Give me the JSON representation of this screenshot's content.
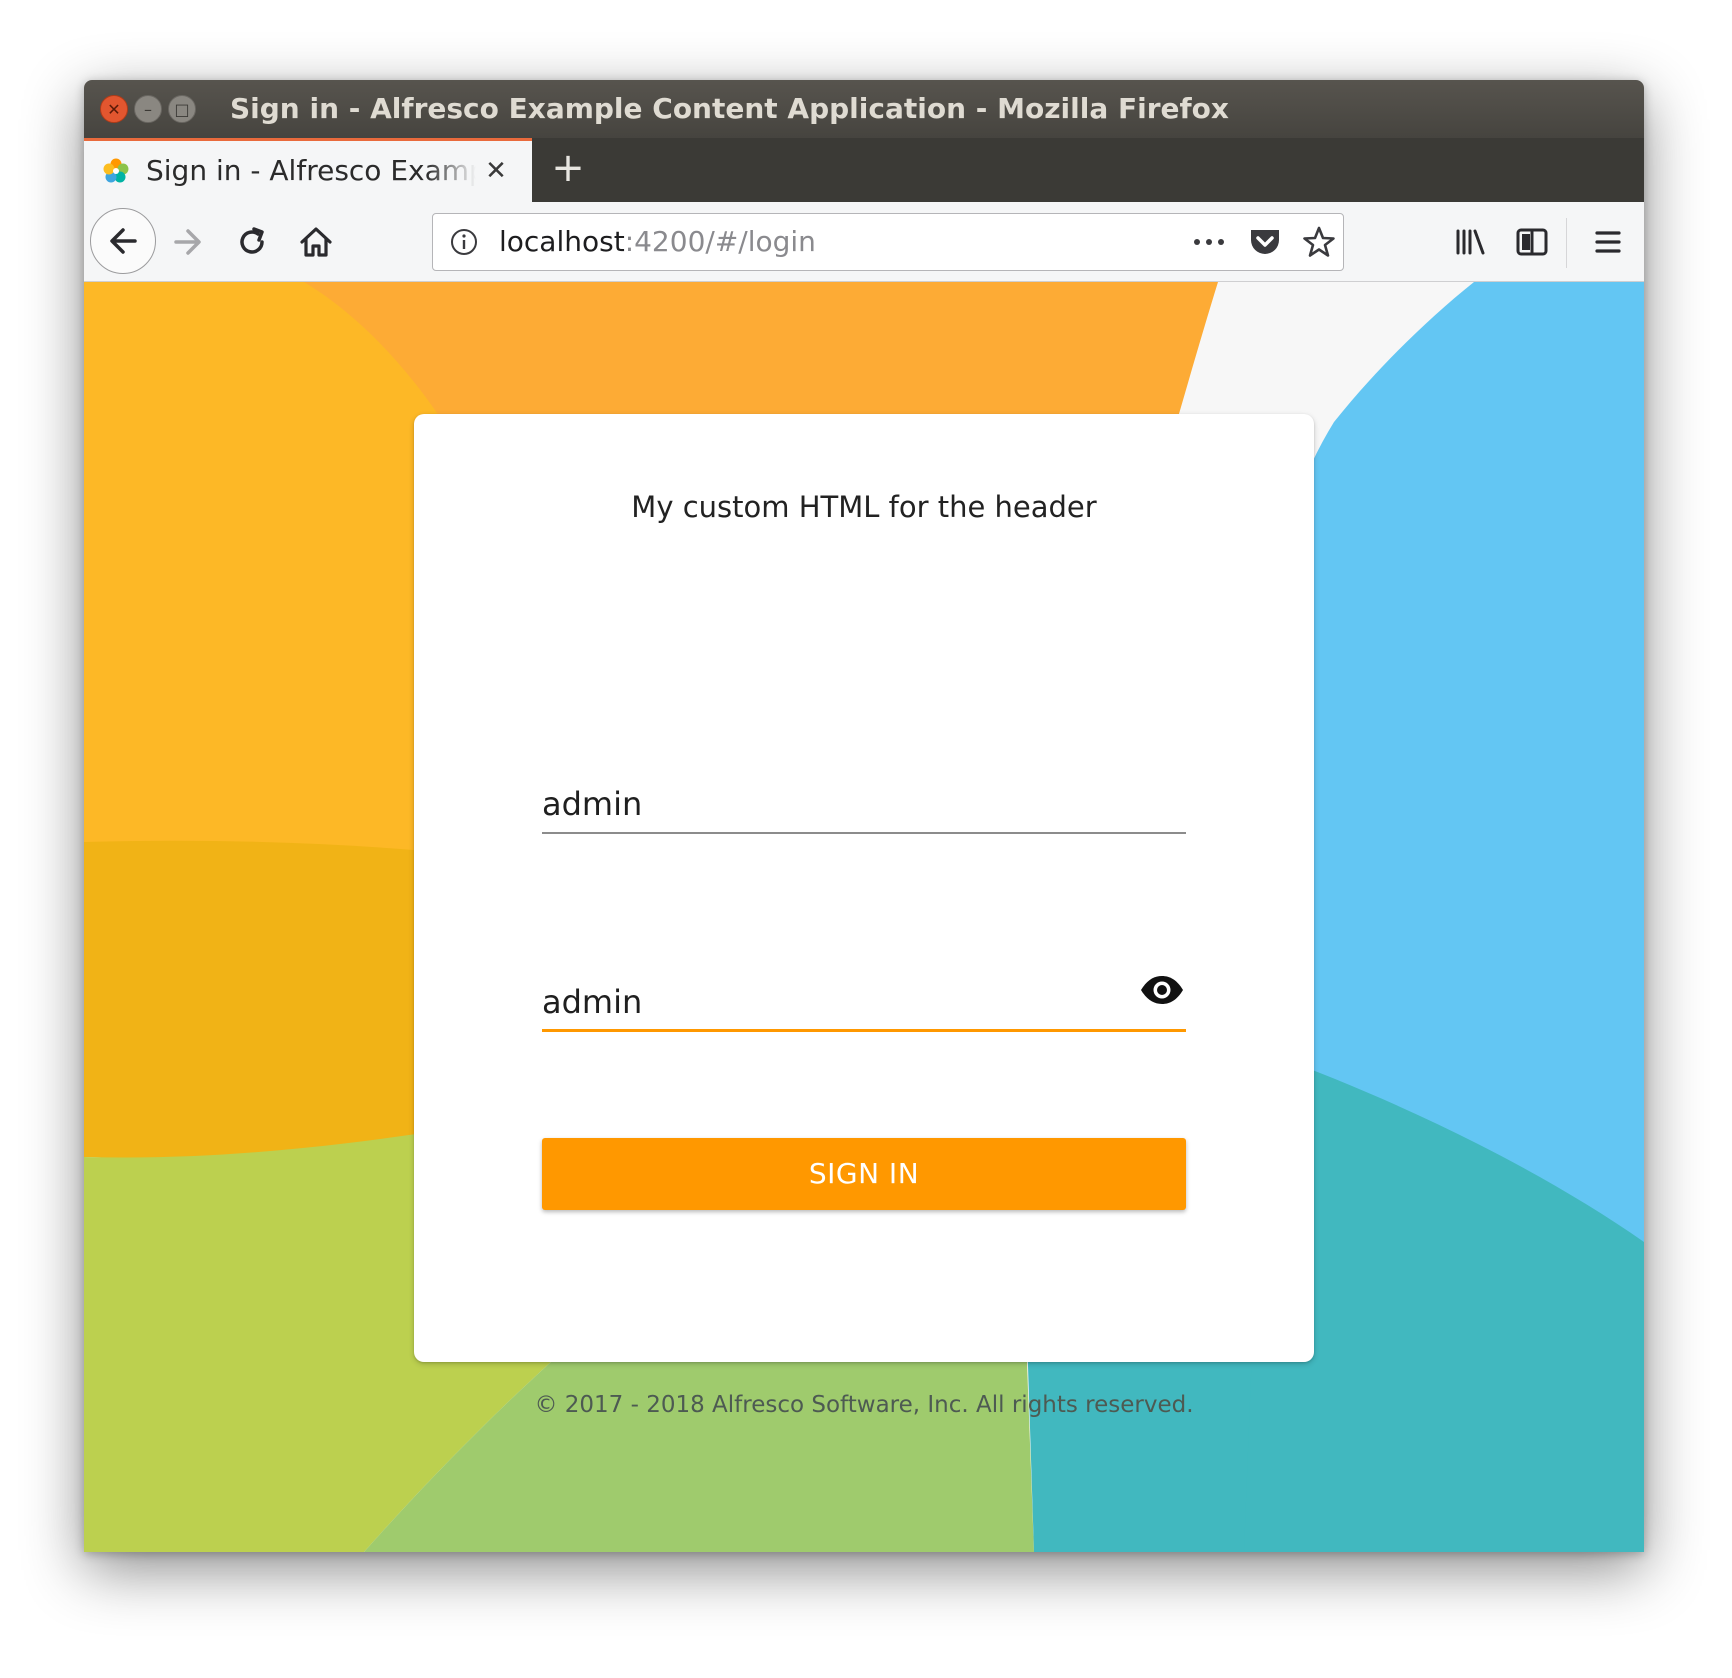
{
  "window": {
    "title": "Sign in - Alfresco Example Content Application - Mozilla Firefox"
  },
  "tab": {
    "title": "Sign in - Alfresco Example Content Application",
    "close_icon": "close-icon",
    "new_tab_icon": "plus-icon"
  },
  "navbar": {
    "url_host": "localhost",
    "url_path": ":4200/#/login",
    "icons": [
      "back-arrow-icon",
      "forward-arrow-icon",
      "reload-icon",
      "home-icon",
      "info-icon",
      "more-icon",
      "pocket-icon",
      "bookmark-star-icon",
      "library-icon",
      "sidebar-icon",
      "hamburger-menu-icon"
    ]
  },
  "login": {
    "header_html": "My custom HTML for the header",
    "username_value": "admin",
    "password_value": "admin",
    "password_toggle_icon": "eye-icon",
    "submit_label": "SIGN IN",
    "copyright": "© 2017 - 2018 Alfresco Software, Inc. All rights reserved."
  },
  "colors": {
    "accent": "#ff9800",
    "tab_highlight": "#e96a3c",
    "bg_orange": "#fdab35",
    "bg_yellow": "#fdb826",
    "bg_gold": "#f1b316",
    "bg_lime": "#bcd04f",
    "bg_green": "#9fcb6d",
    "bg_teal": "#41b8bf",
    "bg_blue": "#63c6f3"
  }
}
